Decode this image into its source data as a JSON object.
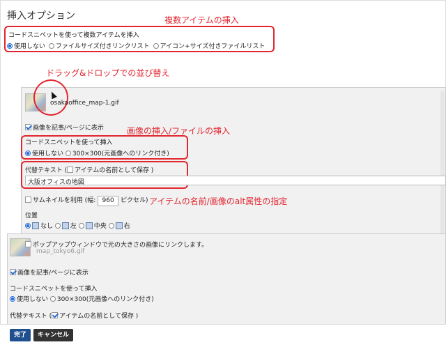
{
  "dialog": {
    "title": "挿入オプション"
  },
  "multi": {
    "label": "コードスニペットを使って複数アイテムを挿入",
    "options": [
      "使用しない",
      "ファイルサイズ付きリンクリスト",
      "アイコン+サイズ付きファイルリスト"
    ],
    "selected_index": 0
  },
  "annotations": {
    "multi": "複数アイテムの挿入",
    "dragdrop": "ドラッグ&ドロップでの並び替え",
    "image_file": "画像の挿入/ファイルの挿入",
    "alt": "アイテムの名前/画像のalt属性の指定"
  },
  "item1": {
    "filename": "osakaoffice_map-1.gif",
    "show_image_label": "画像を記事/ページに表示",
    "show_image_checked": true,
    "snippet_label": "コードスニペットを使って挿入",
    "snippet_options": [
      "使用しない",
      "300×300(元画像へのリンク付き)"
    ],
    "snippet_selected": 0,
    "alt_label": "代替テキスト (",
    "alt_checkbox_label": "アイテムの名前として保存 )",
    "alt_checked": false,
    "alt_value": "大阪オフィスの地図",
    "thumb_label": "サムネイルを利用 (幅:",
    "thumb_width": "960",
    "thumb_unit": "ピクセル)",
    "thumb_checked": false,
    "position_label": "位置",
    "positions": [
      "なし",
      "左",
      "中央",
      "右"
    ],
    "position_selected": 0,
    "popup_label": "ポップアップウィンドウで元の大きさの画像にリンクします。",
    "popup_checked": false
  },
  "item2": {
    "filename": "map_tokyo6.gif",
    "show_image_label": "画像を記事/ページに表示",
    "show_image_checked": true,
    "snippet_label": "コードスニペットを使って挿入",
    "snippet_options": [
      "使用しない",
      "300×300(元画像へのリンク付き)"
    ],
    "snippet_selected": 0,
    "alt_label": "代替テキスト (",
    "alt_checkbox_label": "アイテムの名前として保存 )",
    "alt_checked": true
  },
  "footer": {
    "done": "完了",
    "cancel": "キャンセル"
  },
  "colors": {
    "annotation": "#e2262f",
    "primary": "#1f4f8f",
    "secondary": "#333333",
    "radio_on": "#2a6fd6"
  }
}
